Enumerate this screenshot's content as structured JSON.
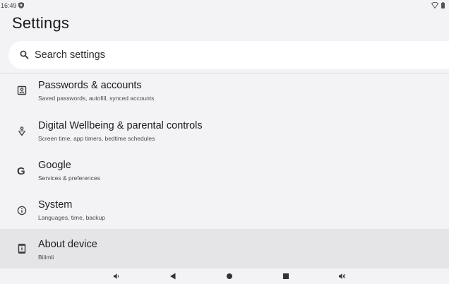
{
  "status_bar": {
    "time": "16:49"
  },
  "page": {
    "title": "Settings"
  },
  "search": {
    "placeholder": "Search settings"
  },
  "items": [
    {
      "icon": "account-box-icon",
      "title": "Passwords & accounts",
      "subtitle": "Saved passwords, autofill, synced accounts"
    },
    {
      "icon": "wellbeing-icon",
      "title": "Digital Wellbeing & parental controls",
      "subtitle": "Screen time, app timers, bedtime schedules"
    },
    {
      "icon": "google-icon",
      "title": "Google",
      "subtitle": "Services & preferences",
      "glyph": "G"
    },
    {
      "icon": "info-icon",
      "title": "System",
      "subtitle": "Languages, time, backup"
    },
    {
      "icon": "device-info-icon",
      "title": "About device",
      "subtitle": "Bilimli"
    }
  ],
  "colors": {
    "background": "#f3f3f6",
    "highlight": "#e5e5e8",
    "search_bg": "#ffffff"
  }
}
